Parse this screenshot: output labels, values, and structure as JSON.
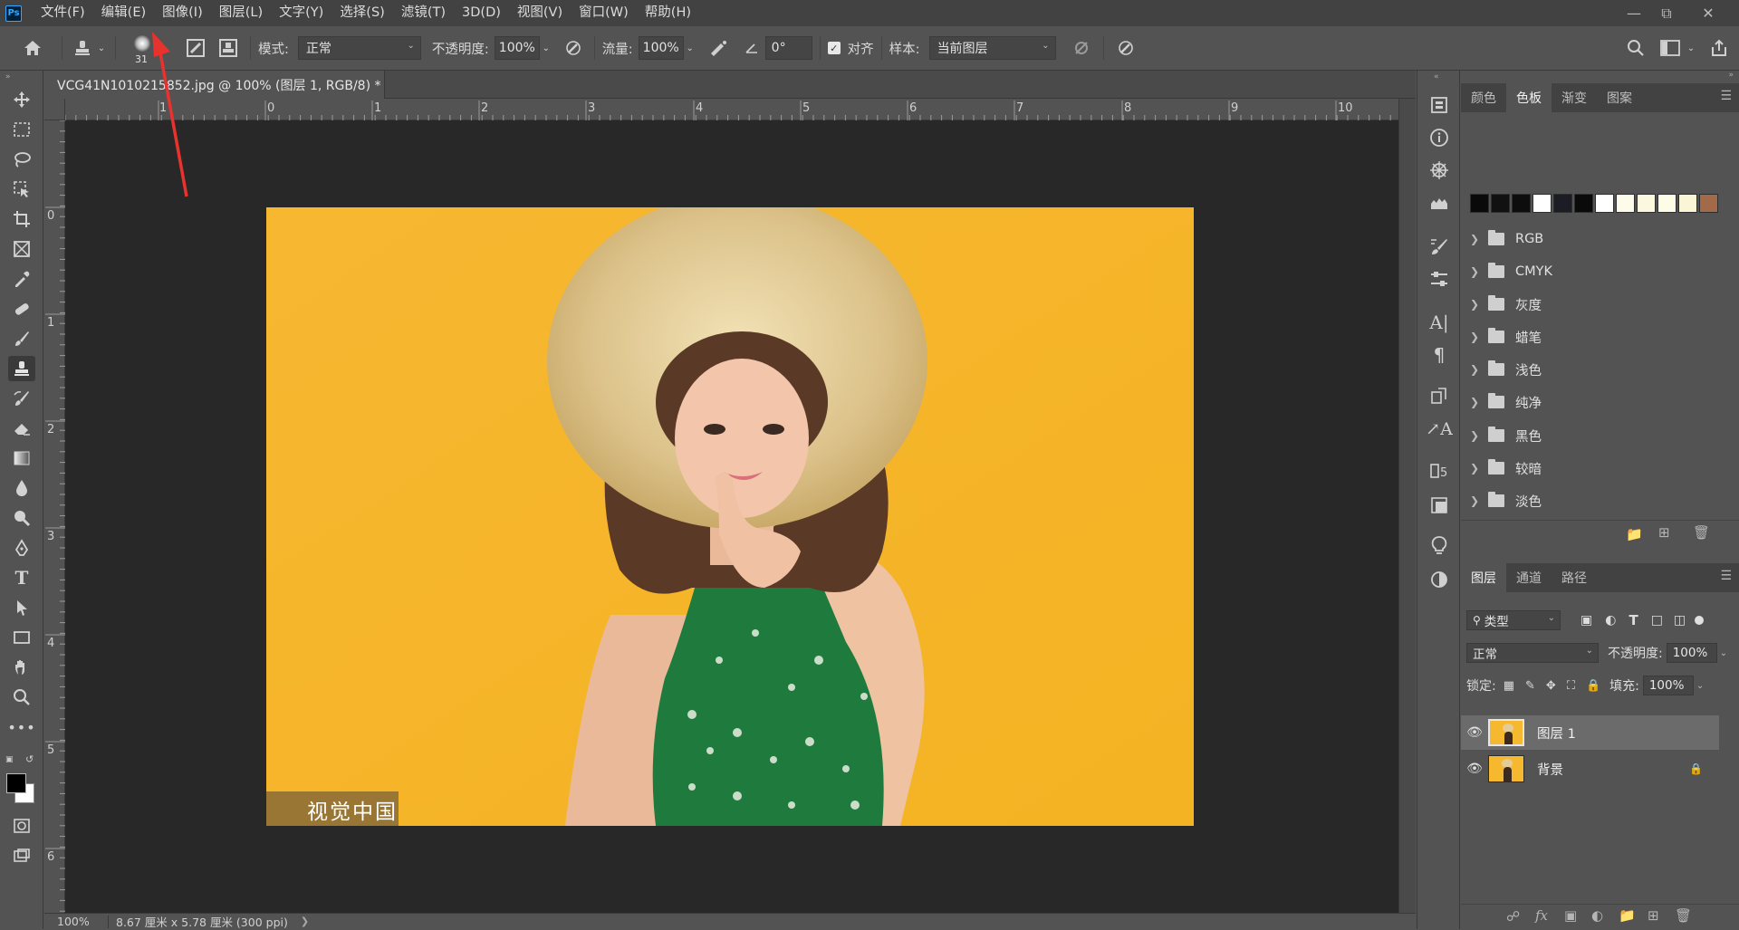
{
  "app": {
    "logo": "Ps"
  },
  "menu": [
    "文件(F)",
    "编辑(E)",
    "图像(I)",
    "图层(L)",
    "文字(Y)",
    "选择(S)",
    "滤镜(T)",
    "3D(D)",
    "视图(V)",
    "窗口(W)",
    "帮助(H)"
  ],
  "options": {
    "brush_size": "31",
    "mode_label": "模式:",
    "mode_value": "正常",
    "opacity_label": "不透明度:",
    "opacity_value": "100%",
    "flow_label": "流量:",
    "flow_value": "100%",
    "angle_value": "0°",
    "align_label": "对齐",
    "align_checked": true,
    "sample_label": "样本:",
    "sample_value": "当前图层"
  },
  "document": {
    "tab_title": "VCG41N1010215852.jpg @ 100% (图层 1, RGB/8) *",
    "watermark": "视觉中国",
    "zoom": "100%",
    "doc_info": "8.67 厘米 x 5.78 厘米 (300 ppi)"
  },
  "ruler": {
    "h_ticks": [
      "1",
      "0",
      "1",
      "2",
      "3",
      "4",
      "5",
      "6",
      "7",
      "8",
      "9",
      "10"
    ],
    "v_ticks": [
      "0",
      "1",
      "2",
      "3",
      "4",
      "5",
      "6"
    ]
  },
  "swatches_panel": {
    "tabs": [
      "颜色",
      "色板",
      "渐变",
      "图案"
    ],
    "active_tab": "色板",
    "swatch_colors": [
      "#0a0a0a",
      "#111111",
      "#0d0d0d",
      "#ffffff",
      "#1c1c24",
      "#0a0a0a",
      "#ffffff",
      "#fdfbe9",
      "#fcf8e0",
      "#fdfce6",
      "#fbf5d8",
      "#a36a4a"
    ],
    "groups": [
      "RGB",
      "CMYK",
      "灰度",
      "蜡笔",
      "浅色",
      "纯净",
      "黑色",
      "较暗",
      "淡色"
    ]
  },
  "layers_panel": {
    "tabs": [
      "图层",
      "通道",
      "路径"
    ],
    "active_tab": "图层",
    "filter_value": "类型",
    "blend_mode": "正常",
    "opacity_label": "不透明度:",
    "opacity_value": "100%",
    "lock_label": "锁定:",
    "fill_label": "填充:",
    "fill_value": "100%",
    "layers": [
      {
        "name": "图层 1",
        "selected": true,
        "locked": false
      },
      {
        "name": "背景",
        "selected": false,
        "locked": true
      }
    ]
  }
}
